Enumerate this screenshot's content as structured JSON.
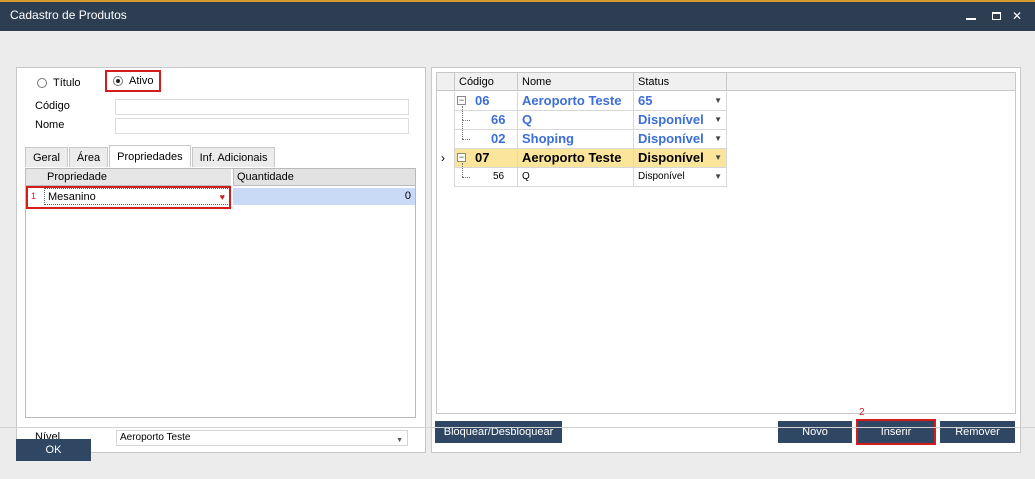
{
  "window": {
    "title": "Cadastro de Produtos"
  },
  "form": {
    "radio_titulo": "Título",
    "radio_ativo": "Ativo",
    "codigo_label": "Código",
    "nome_label": "Nome",
    "codigo_value": "",
    "nome_value": "",
    "nivel_label": "Nível",
    "nivel_value": "Aeroporto Teste"
  },
  "tabs": [
    {
      "label": "Geral"
    },
    {
      "label": "Área"
    },
    {
      "label": "Propriedades"
    },
    {
      "label": "Inf. Adicionais"
    }
  ],
  "prop_grid": {
    "headers": [
      "Propriedade",
      "Quantidade"
    ],
    "rows": [
      {
        "num": "1",
        "propriedade": "Mesanino",
        "quantidade": "0"
      }
    ]
  },
  "tree_grid": {
    "headers": [
      "Código",
      "Nome",
      "Status"
    ],
    "rows": [
      {
        "codigo": "06",
        "nome": "Aeroporto Teste",
        "status": "65"
      },
      {
        "codigo": "66",
        "nome": "Q",
        "status": "Disponível"
      },
      {
        "codigo": "02",
        "nome": "Shoping",
        "status": "Disponível"
      },
      {
        "codigo": "07",
        "nome": "Aeroporto Teste",
        "status": "Disponível"
      },
      {
        "codigo": "56",
        "nome": "Q",
        "status": "Disponível"
      }
    ]
  },
  "buttons": {
    "bloquear": "Bloquear/Desbloquear",
    "novo": "Novo",
    "inserir": "Inserir",
    "remover": "Remover",
    "ok": "OK",
    "inserir_badge": "2"
  },
  "colors": {
    "titlebar": "#2d3e52",
    "accent": "#d89a2a",
    "button": "#2f4763",
    "highlight": "#d31d1d",
    "link_blue": "#3c6ed8",
    "selected_row": "#fbe59a"
  }
}
